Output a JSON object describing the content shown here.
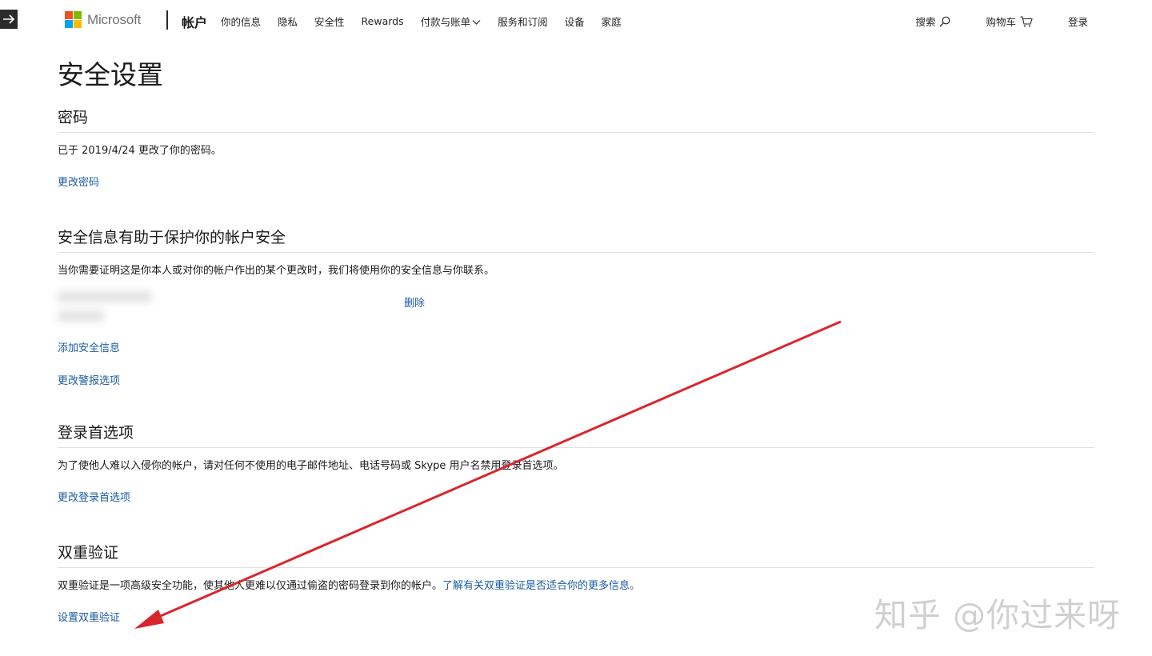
{
  "nav": {
    "brand": "Microsoft",
    "account": "帐户",
    "links": [
      "你的信息",
      "隐私",
      "安全性",
      "Rewards",
      "付款与账单",
      "服务和订阅",
      "设备",
      "家庭"
    ],
    "search": "搜索",
    "cart": "购物车",
    "signin": "登录"
  },
  "page": {
    "title": "安全设置"
  },
  "password": {
    "heading": "密码",
    "last_changed": "已于 2019/4/24 更改了你的密码。",
    "change_link": "更改密码"
  },
  "security_info": {
    "heading": "安全信息有助于保护你的帐户安全",
    "description": "当你需要证明这是你本人或对你的帐户作出的某个更改时，我们将使用你的安全信息与你联系。",
    "remove_link": "删除",
    "add_link": "添加安全信息",
    "alerts_link": "更改警报选项"
  },
  "signin_prefs": {
    "heading": "登录首选项",
    "description": "为了使他人难以入侵你的帐户，请对任何不使用的电子邮件地址、电话号码或 Skype 用户名禁用登录首选项。",
    "change_link": "更改登录首选项"
  },
  "two_step": {
    "heading": "双重验证",
    "description": "双重验证是一项高级安全功能，使其他人更难以仅通过偷盗的密码登录到你的帐户。",
    "learn_more": "了解有关双重验证是否适合你的更多信息。",
    "setup_link": "设置双重验证"
  },
  "watermark": "知乎 @你过来呀",
  "colors": {
    "link": "#1a5b9f",
    "logo_red": "#f25022",
    "logo_green": "#7fba00",
    "logo_blue": "#00a4ef",
    "logo_yellow": "#ffb900",
    "annotation_arrow": "#d9262c"
  }
}
